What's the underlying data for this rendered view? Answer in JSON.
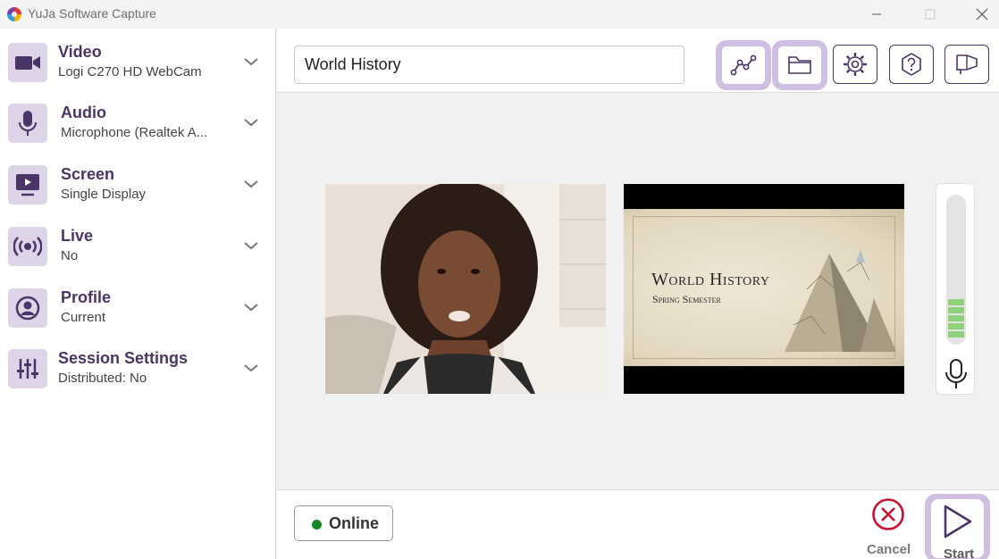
{
  "window": {
    "title": "YuJa Software Capture",
    "icons": {
      "logo": "yuja-logo-icon",
      "minimize": "minimize-icon",
      "maximize": "maximize-icon",
      "close": "close-icon"
    }
  },
  "sidebar": {
    "items": [
      {
        "title": "Video",
        "subtitle": "Logi C270 HD WebCam",
        "icon": "video-camera-icon"
      },
      {
        "title": "Audio",
        "subtitle": "Microphone (Realtek A...",
        "icon": "microphone-icon"
      },
      {
        "title": "Screen",
        "subtitle": "Single Display",
        "icon": "screen-icon"
      },
      {
        "title": "Live",
        "subtitle": "No",
        "icon": "broadcast-icon"
      },
      {
        "title": "Profile",
        "subtitle": "Current",
        "icon": "profile-icon"
      },
      {
        "title": "Session Settings",
        "subtitle": "Distributed: No",
        "icon": "sliders-icon"
      }
    ]
  },
  "toolbar": {
    "title_value": "World History",
    "buttons": [
      "analytics-icon",
      "folder-icon",
      "settings-icon",
      "help-icon",
      "announcement-icon"
    ]
  },
  "preview": {
    "slide_title": "World History",
    "slide_subtitle": "Spring Semester"
  },
  "audio_meter": {
    "level_fraction": 0.27
  },
  "footer": {
    "status_label": "Online",
    "status_color": "#138a2a",
    "cancel_label": "Cancel",
    "start_label": "Start"
  },
  "colors": {
    "accent": "#4a3468",
    "highlight": "#cfc0e3",
    "cancel": "#c8102e"
  }
}
